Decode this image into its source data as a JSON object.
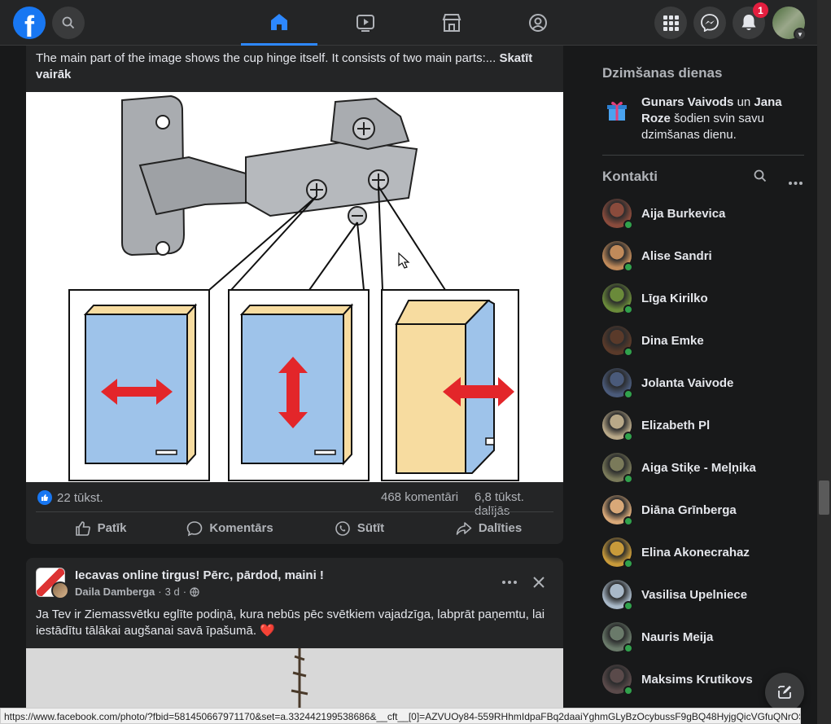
{
  "topbar": {
    "logo_letter": "f",
    "notifications_count": "1",
    "tabs": [
      {
        "name": "home",
        "active": true
      },
      {
        "name": "watch",
        "active": false
      },
      {
        "name": "marketplace",
        "active": false
      },
      {
        "name": "groups",
        "active": false
      }
    ]
  },
  "post1": {
    "text": "The main part of the image shows the cup hinge itself. It consists of two main parts:...",
    "see_more": "Skatīt vairāk",
    "likes": "22 tūkst.",
    "comments": "468 komentāri",
    "shares": "6,8 tūkst. dalījās",
    "actions": {
      "like": "Patīk",
      "comment": "Komentārs",
      "send": "Sūtīt",
      "share": "Dalīties"
    }
  },
  "post2": {
    "group": "Iecavas online tirgus! Pērc, pārdod, maini !",
    "author": "Daila Damberga",
    "time": "3 d",
    "separator": "·",
    "text": "Ja Tev ir Ziemassvētku eglīte podiņā, kura nebūs pēc svētkiem vajadzīga, labprāt paņemtu, lai iestādītu tālākai augšanai savā īpašumā.",
    "emoji": "❤️"
  },
  "birthdays": {
    "title": "Dzimšanas dienas",
    "name1": "Gunars Vaivods",
    "connector": "un",
    "name2": "Jana Roze",
    "rest": "šodien svin savu dzimšanas dienu."
  },
  "contacts": {
    "title": "Kontakti",
    "items": [
      {
        "name": "Aija Burkevica",
        "color": "#8a4b3c"
      },
      {
        "name": "Alise Sandri",
        "color": "#c08a5a"
      },
      {
        "name": "Līga Kirilko",
        "color": "#6a8a3a"
      },
      {
        "name": "Dina Emke",
        "color": "#5a3a2a"
      },
      {
        "name": "Jolanta Vaivode",
        "color": "#4a5a7a"
      },
      {
        "name": "Elizabeth Pl",
        "color": "#b8a888"
      },
      {
        "name": "Aiga Stiķe - Meļņika",
        "color": "#7a7a5a"
      },
      {
        "name": "Diāna Grīnberga",
        "color": "#d8a878"
      },
      {
        "name": "Elina Akonecrahaz",
        "color": "#c89a3a"
      },
      {
        "name": "Vasilisa Upelniece",
        "color": "#a8b8c8"
      },
      {
        "name": "Nauris Meija",
        "color": "#6a7a6a"
      },
      {
        "name": "Maksims Krutikovs",
        "color": "#5a4a4a"
      }
    ]
  },
  "status_url": "https://www.facebook.com/photo/?fbid=581450667971170&set=a.332442199538686&__cft__[0]=AZVUOy84-559RHhmIdpaFBq2daaiYghmGLyBzOcybussF9gBQ48HyjgQicVGfuQNrOS..."
}
